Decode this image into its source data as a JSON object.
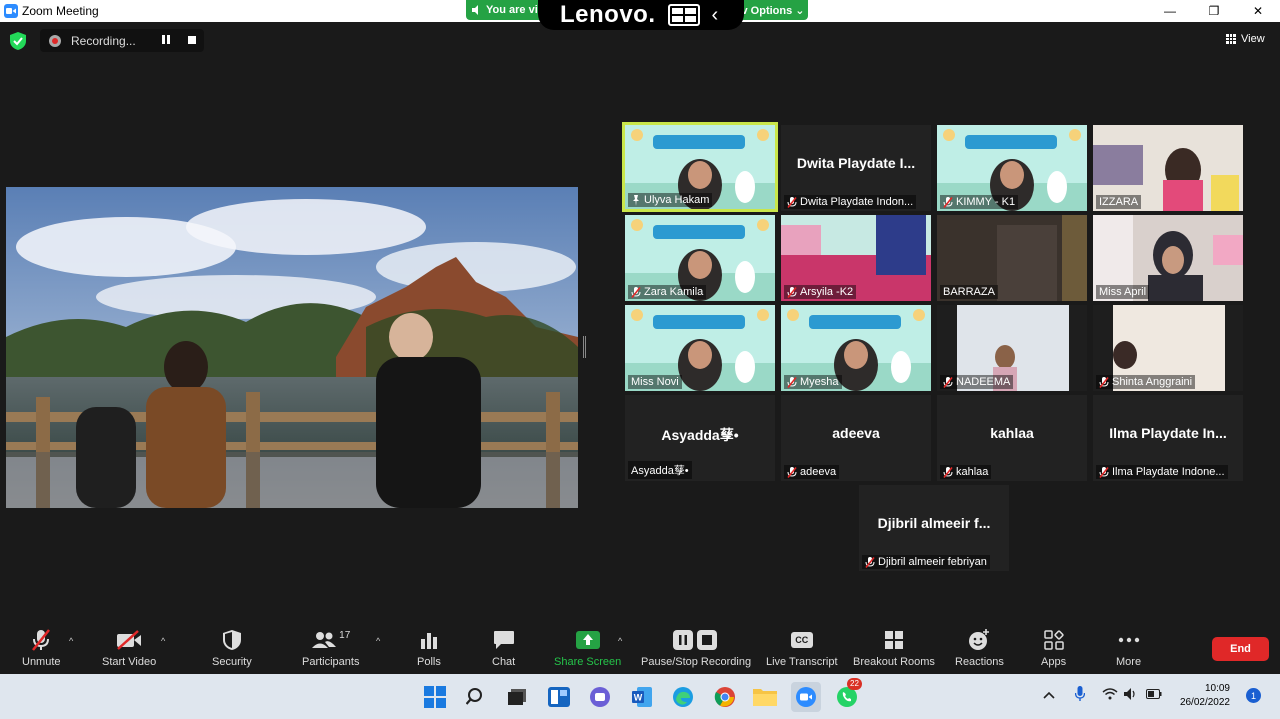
{
  "window": {
    "title": "Zoom Meeting",
    "minimize": "—",
    "restore": "❐",
    "close": "✕"
  },
  "banner": {
    "viewing_text": "You are vi",
    "brand": "Lenovo.",
    "view_options": "v Options ⌄"
  },
  "meeting": {
    "recording_label": "Recording...",
    "view_label": "View"
  },
  "participants": [
    {
      "display": "",
      "name": "Ulyva Hakam",
      "muted": false,
      "pinned": true
    },
    {
      "display": "Dwita Playdate I...",
      "name": "Dwita Playdate Indon...",
      "muted": true
    },
    {
      "display": "",
      "name": "KIMMY - K1",
      "muted": true
    },
    {
      "display": "",
      "name": "IZZARA",
      "muted": false
    },
    {
      "display": "",
      "name": "Zara Kamila",
      "muted": true
    },
    {
      "display": "",
      "name": "Arsyila -K2",
      "muted": true
    },
    {
      "display": "",
      "name": "BARRAZA",
      "muted": false
    },
    {
      "display": "",
      "name": "Miss April",
      "muted": false
    },
    {
      "display": "",
      "name": "Miss Novi",
      "muted": false
    },
    {
      "display": "",
      "name": "Myesha",
      "muted": true
    },
    {
      "display": "",
      "name": "NADEEMA",
      "muted": true
    },
    {
      "display": "",
      "name": "Shinta Anggraini",
      "muted": true
    },
    {
      "display": "Asyadda孶•",
      "name": "Asyadda孶•",
      "muted": false
    },
    {
      "display": "adeeva",
      "name": "adeeva",
      "muted": true
    },
    {
      "display": "kahlaa",
      "name": "kahlaa",
      "muted": true
    },
    {
      "display": "Ilma Playdate In...",
      "name": "Ilma Playdate Indone...",
      "muted": true
    },
    {
      "display": "Djibril almeeir f...",
      "name": "Djibril almeeir febriyan",
      "muted": true
    }
  ],
  "toolbar": {
    "unmute": "Unmute",
    "start_video": "Start Video",
    "security": "Security",
    "participants": "Participants",
    "participants_count": "17",
    "polls": "Polls",
    "chat": "Chat",
    "share_screen": "Share Screen",
    "pause_stop": "Pause/Stop Recording",
    "live_transcript": "Live Transcript",
    "breakout_rooms": "Breakout Rooms",
    "reactions": "Reactions",
    "apps": "Apps",
    "more": "More",
    "end": "End",
    "cc": "CC"
  },
  "taskbar": {
    "time": "10:09",
    "date": "26/02/2022",
    "whatsapp_badge": "22",
    "notifications": "1"
  },
  "colors": {
    "accent_green": "#25a244",
    "end_red": "#e02828",
    "active_speaker": "#c9e64a"
  }
}
